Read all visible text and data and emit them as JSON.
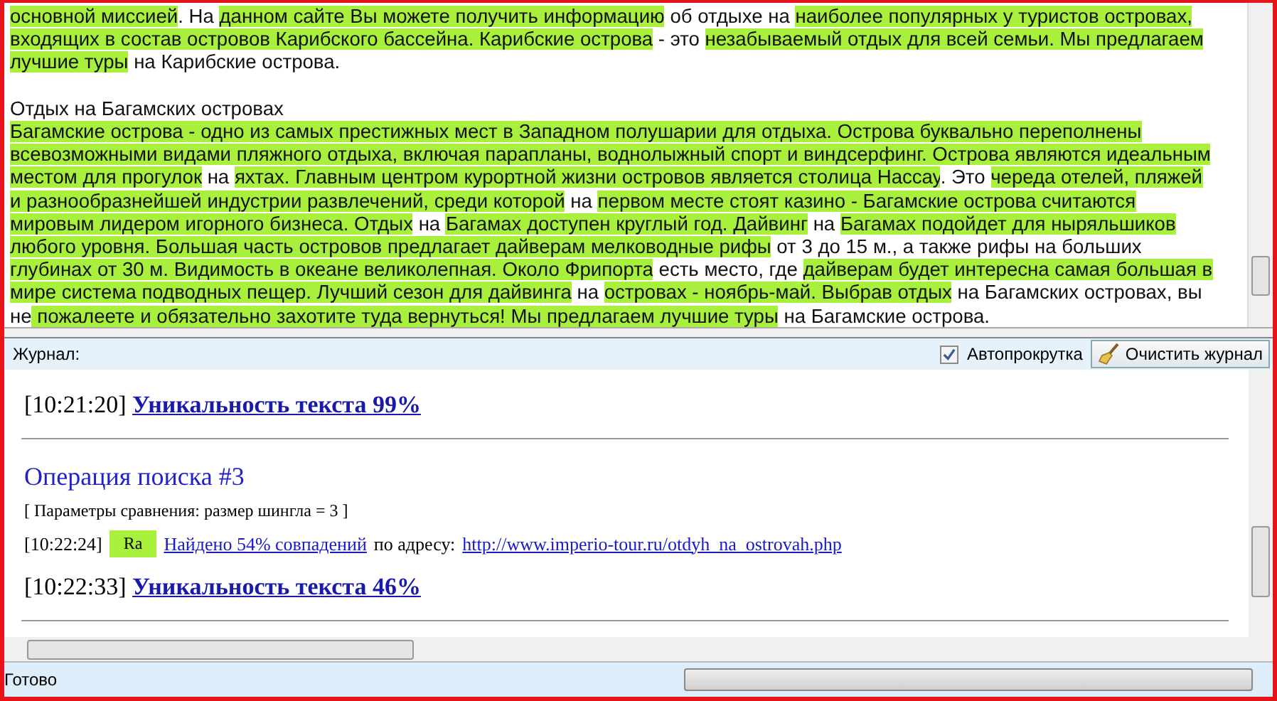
{
  "document": {
    "paragraphs": [
      {
        "lines": [
          [
            {
              "text": "основной миссией",
              "highlighted": true
            },
            {
              "text": ". На ",
              "highlighted": false
            },
            {
              "text": "данном сайте Вы можете получить информацию",
              "highlighted": true
            },
            {
              "text": " об отдыхе на ",
              "highlighted": false
            },
            {
              "text": "наиболее популярных у туристов островах,",
              "highlighted": true
            }
          ],
          [
            {
              "text": "входящих в состав островов Карибского бассейна. Карибские острова",
              "highlighted": true
            },
            {
              "text": " - это ",
              "highlighted": false
            },
            {
              "text": "незабываемый отдых для всей семьи. Мы предлагаем",
              "highlighted": true
            }
          ],
          [
            {
              "text": "лучшие туры",
              "highlighted": true
            },
            {
              "text": " на Карибские острова.",
              "highlighted": false
            }
          ]
        ]
      },
      {
        "lines": [
          [
            {
              "text": "Отдых на Багамских островах",
              "highlighted": false
            }
          ],
          [
            {
              "text": "Багамские острова - одно из самых престижных мест в Западном полушарии для отдыха. Острова буквально переполнены",
              "highlighted": true
            }
          ],
          [
            {
              "text": "всевозможными видами пляжного отдыха, включая парапланы, воднолыжный спорт и виндсерфинг. Острова являются идеальным",
              "highlighted": true
            }
          ],
          [
            {
              "text": "местом для прогулок",
              "highlighted": true
            },
            {
              "text": " на ",
              "highlighted": false
            },
            {
              "text": "яхтах. Главным центром курортной жизни островов является столица Нассау",
              "highlighted": true
            },
            {
              "text": ". Это ",
              "highlighted": false
            },
            {
              "text": "череда отелей, пляжей",
              "highlighted": true
            }
          ],
          [
            {
              "text": "и разнообразнейшей индустрии развлечений, среди которой",
              "highlighted": true
            },
            {
              "text": " на ",
              "highlighted": false
            },
            {
              "text": "первом месте стоят казино - Багамские острова считаются",
              "highlighted": true
            }
          ],
          [
            {
              "text": "мировым лидером игорного бизнеса. Отдых",
              "highlighted": true
            },
            {
              "text": " на ",
              "highlighted": false
            },
            {
              "text": "Багамах доступен круглый год. Дайвинг",
              "highlighted": true
            },
            {
              "text": " на ",
              "highlighted": false
            },
            {
              "text": "Багамах подойдет для ныряльшиков",
              "highlighted": true
            }
          ],
          [
            {
              "text": "любого уровня. Большая часть островов предлагает дайверам мелководные рифы",
              "highlighted": true
            },
            {
              "text": " от 3 до 15 м., а также рифы на больших",
              "highlighted": false
            }
          ],
          [
            {
              "text": "глубинах от",
              "highlighted": true
            },
            {
              "text": " 30 м. Видимость в океане великолепная. Около Фрипорта",
              "highlighted": true
            },
            {
              "text": " есть место, где ",
              "highlighted": false
            },
            {
              "text": "дайверам будет интересна самая большая в",
              "highlighted": true
            }
          ],
          [
            {
              "text": "мире система подводных пещер. Лучший сезон для дайвинга",
              "highlighted": true
            },
            {
              "text": " на ",
              "highlighted": false
            },
            {
              "text": "островах - ноябрь-май. Выбрав отдых",
              "highlighted": true
            },
            {
              "text": " на Багамских островах, вы",
              "highlighted": false
            }
          ],
          [
            {
              "text": "не",
              "highlighted": false
            },
            {
              "text": " пожалеете и обязательно захотите туда вернуться! Мы предлагаем лучшие туры",
              "highlighted": true
            },
            {
              "text": " на Багамские острова.",
              "highlighted": false
            }
          ]
        ]
      }
    ]
  },
  "log_toolbar": {
    "label": "Журнал:",
    "autoscroll": {
      "label": "Автопрокрутка",
      "checked": true
    },
    "clear_button": "Очистить журнал"
  },
  "log": [
    {
      "kind": "result",
      "time": "[10:21:20]",
      "text": "Уникальность текста 99%"
    },
    {
      "kind": "separator"
    },
    {
      "kind": "heading",
      "text": "Операция поиска #3"
    },
    {
      "kind": "params",
      "text": "[ Параметры сравнения: размер шингла = 3 ]"
    },
    {
      "kind": "match",
      "time": "[10:22:24]",
      "badge": "Ra",
      "color": "#a8f03c",
      "link": "Найдено 54% совпадений",
      "middle": "по адресу:",
      "url": "http://www.imperio-tour.ru/otdyh_na_ostrovah.php"
    },
    {
      "kind": "result",
      "time": "[10:22:33]",
      "text": "Уникальность текста 46%"
    },
    {
      "kind": "separator"
    }
  ],
  "status_bar": {
    "text": "Готово",
    "progress": {
      "level": 0
    }
  }
}
